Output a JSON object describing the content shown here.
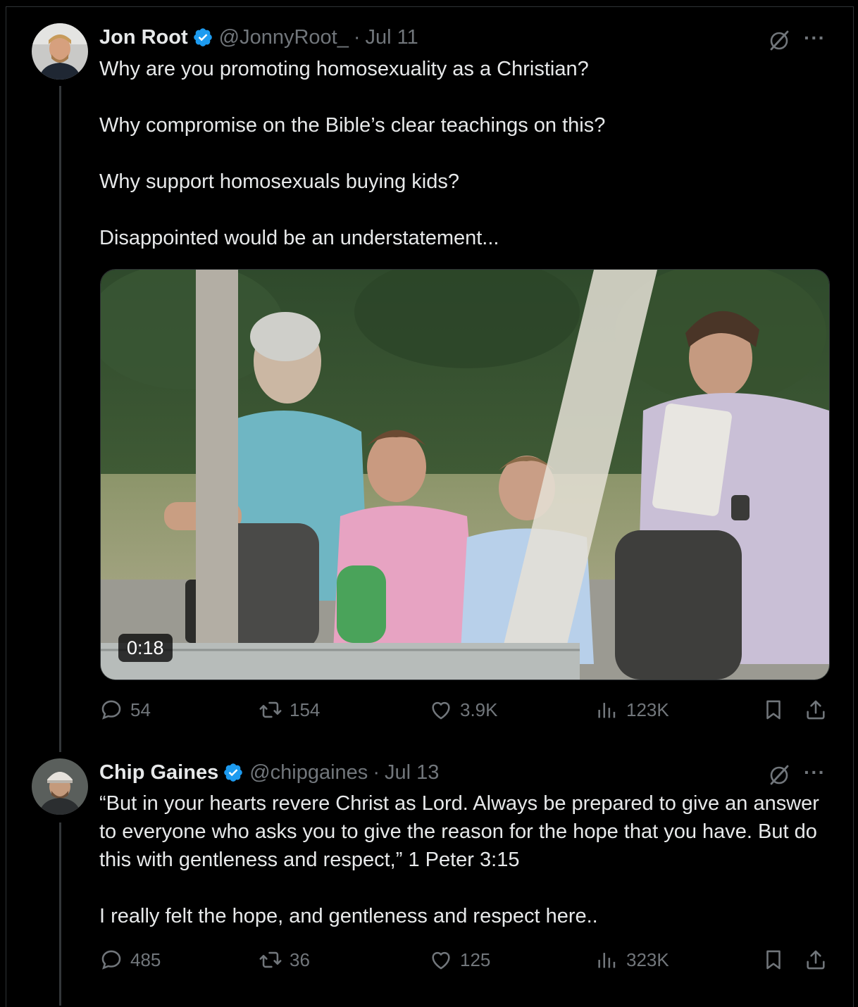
{
  "tweets": [
    {
      "name": "Jon Root",
      "handle": "@JonnyRoot_",
      "separator": "·",
      "date": "Jul 11",
      "paragraphs": [
        "Why are you promoting homosexuality as a Christian?",
        "Why compromise on the Bible’s clear teachings on this?",
        "Why support homosexuals buying kids?",
        "Disappointed would be an understatement..."
      ],
      "video_duration": "0:18",
      "stats": {
        "replies": "54",
        "reposts": "154",
        "likes": "3.9K",
        "views": "123K"
      }
    },
    {
      "name": "Chip Gaines",
      "handle": "@chipgaines",
      "separator": "·",
      "date": "Jul 13",
      "paragraphs": [
        "“But in your hearts revere Christ as Lord. Always be prepared to give an answer to everyone who asks you to give the reason for the hope that you have. But do this with gentleness and respect,” 1 Peter 3:15",
        "I really felt the hope, and gentleness and respect here.."
      ],
      "stats": {
        "replies": "485",
        "reposts": "36",
        "likes": "125",
        "views": "323K"
      }
    }
  ],
  "more_label": "···",
  "icons": [
    "verified-badge-icon",
    "grok-icon",
    "more-icon",
    "reply-icon",
    "repost-icon",
    "like-icon",
    "views-icon",
    "bookmark-icon",
    "share-icon"
  ],
  "colors": {
    "background": "#000000",
    "text": "#e7e9ea",
    "secondary": "#71767b",
    "verified": "#1d9bf0"
  }
}
